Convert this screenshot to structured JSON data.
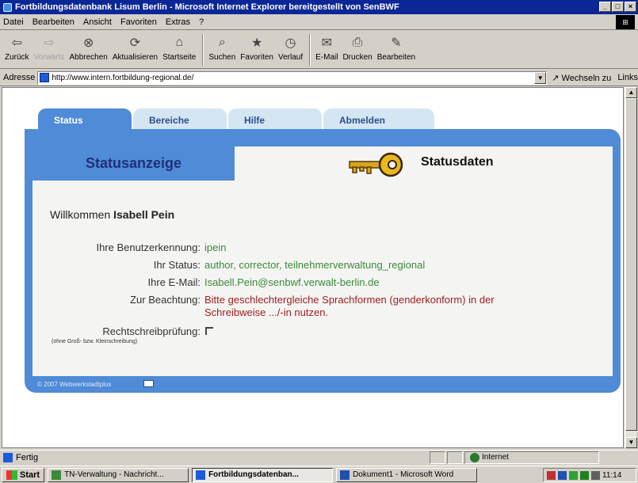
{
  "window": {
    "title": "Fortbildungsdatenbank Lisum Berlin - Microsoft Internet Explorer bereitgestellt von SenBWF",
    "buttons": [
      "_",
      "□",
      "×"
    ]
  },
  "menu": [
    "Datei",
    "Bearbeiten",
    "Ansicht",
    "Favoriten",
    "Extras",
    "?"
  ],
  "toolbar": [
    {
      "label": "Zurück",
      "icon": "back-arrow-icon"
    },
    {
      "label": "Vorwärts",
      "icon": "forward-arrow-icon"
    },
    {
      "label": "Abbrechen",
      "icon": "stop-icon"
    },
    {
      "label": "Aktualisieren",
      "icon": "refresh-icon"
    },
    {
      "label": "Startseite",
      "icon": "home-icon"
    },
    {
      "label": "Suchen",
      "icon": "search-icon"
    },
    {
      "label": "Favoriten",
      "icon": "favorites-icon"
    },
    {
      "label": "Verlauf",
      "icon": "history-icon"
    },
    {
      "label": "E-Mail",
      "icon": "mail-icon"
    },
    {
      "label": "Drucken",
      "icon": "print-icon"
    },
    {
      "label": "Bearbeiten",
      "icon": "edit-icon"
    }
  ],
  "address": {
    "label": "Adresse",
    "url": "http://www.intern.fortbildung-regional.de/",
    "go": "Wechseln zu",
    "links": "Links"
  },
  "tabs": [
    "Status",
    "Bereiche",
    "Hilfe",
    "Abmelden"
  ],
  "header": {
    "left": "Statusanzeige",
    "right": "Statusdaten"
  },
  "welcome": {
    "prefix": "Willkommen",
    "name": "Isabell Pein"
  },
  "fields": [
    {
      "key": "Ihre Benutzerkennung:",
      "value": "ipein",
      "color": "#3a8a3a"
    },
    {
      "key": "Ihr Status:",
      "value": "author, corrector, teilnehmerverwaltung_regional",
      "color": "#3a8a3a"
    },
    {
      "key": "Ihre E-Mail:",
      "value": "Isabell.Pein@senbwf.verwalt-berlin.de",
      "color": "#3a8a3a"
    },
    {
      "key": "Zur Beachtung:",
      "value": "Bitte geschlechtergleiche Sprachformen (genderkonform) in der Schreibweise .../-in nutzen.",
      "color": "#a02020"
    }
  ],
  "spellcheck": {
    "label": "Rechtschreibprüfung:",
    "sublabel": "(ohne Groß- bzw. Kleinschreibung)"
  },
  "footer": "© 2007 Webwerkstadtplus",
  "statusbar": {
    "left": "Fertig",
    "zone": "Internet"
  },
  "taskbar": {
    "start": "Start",
    "tasks": [
      {
        "label": "TN-Verwaltung - Nachricht...",
        "active": false
      },
      {
        "label": "Fortbildungsdatenban...",
        "active": true
      },
      {
        "label": "Dokument1 - Microsoft Word",
        "active": false
      }
    ],
    "clock": "11:14"
  },
  "colors": {
    "accent": "#4f8bd6",
    "tab_inactive": "#d4e6f2",
    "green_value": "#3a8a3a",
    "red_value": "#a02020"
  }
}
